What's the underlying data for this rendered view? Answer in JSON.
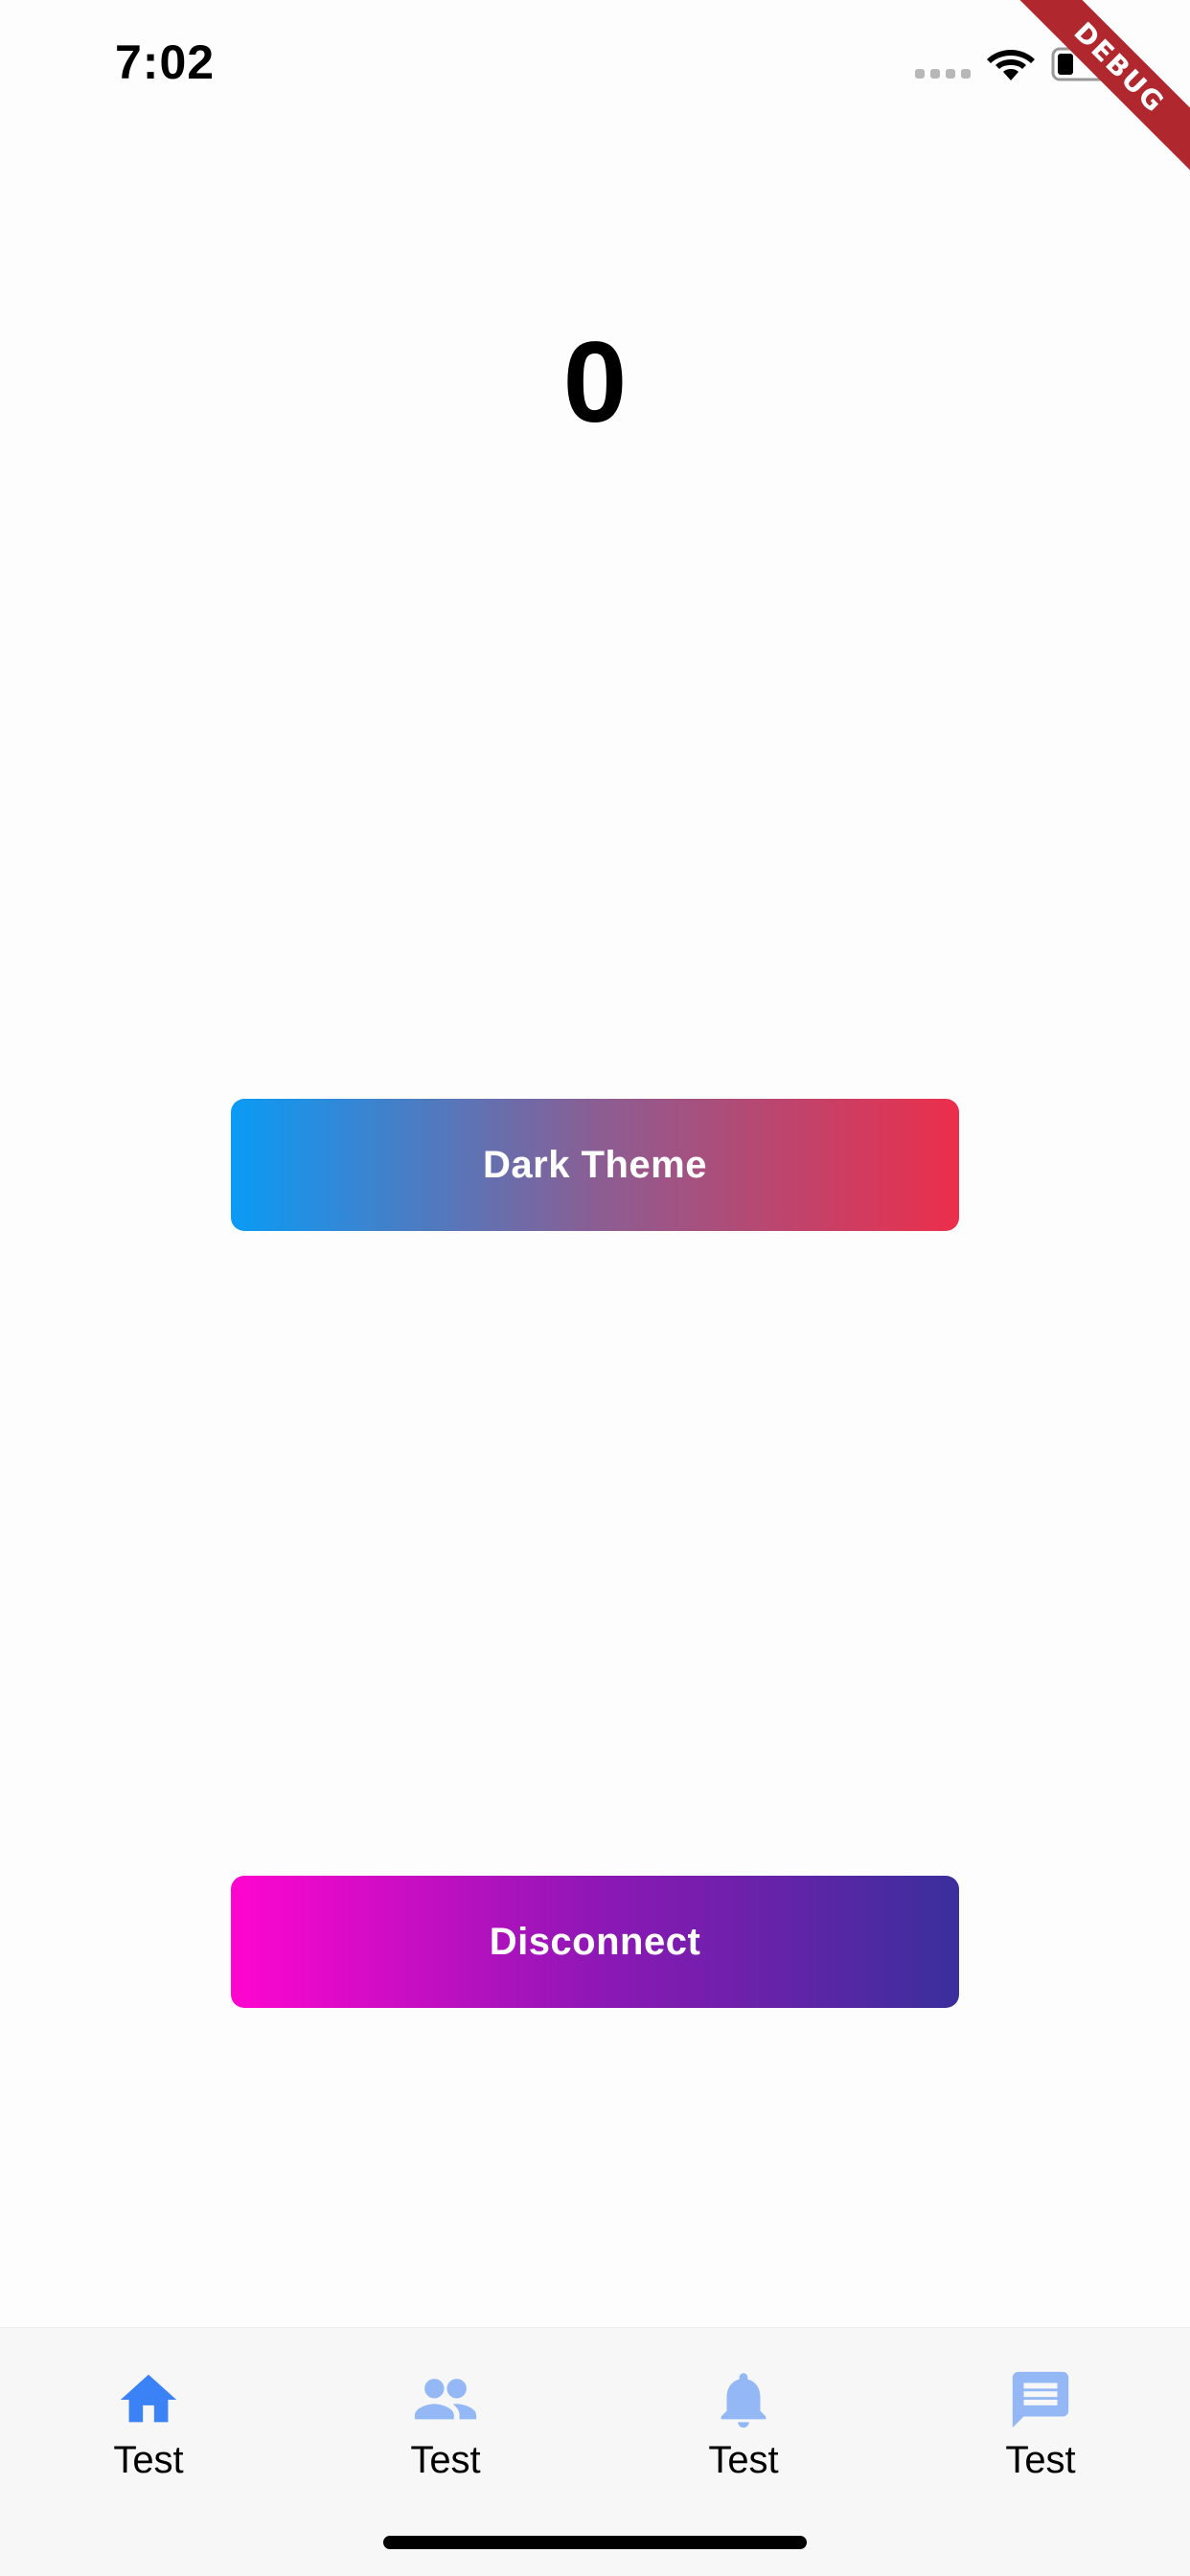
{
  "status_bar": {
    "time": "7:02"
  },
  "debug_banner": {
    "label": "DEBUG"
  },
  "counter": {
    "value": "0"
  },
  "buttons": {
    "dark_theme": "Dark Theme",
    "disconnect": "Disconnect"
  },
  "bottom_nav": {
    "items": [
      {
        "label": "Test",
        "icon": "home-icon",
        "active": true
      },
      {
        "label": "Test",
        "icon": "people-icon",
        "active": false
      },
      {
        "label": "Test",
        "icon": "bell-icon",
        "active": false
      },
      {
        "label": "Test",
        "icon": "message-icon",
        "active": false
      }
    ]
  },
  "colors": {
    "nav_active": "#3b82f6",
    "nav_inactive": "#93b8f5",
    "dark_theme_gradient": [
      "#0a9bf5",
      "#ec2e4b"
    ],
    "disconnect_gradient": [
      "#ff05cf",
      "#3a2f9c"
    ],
    "debug_banner": "#b0282e"
  }
}
